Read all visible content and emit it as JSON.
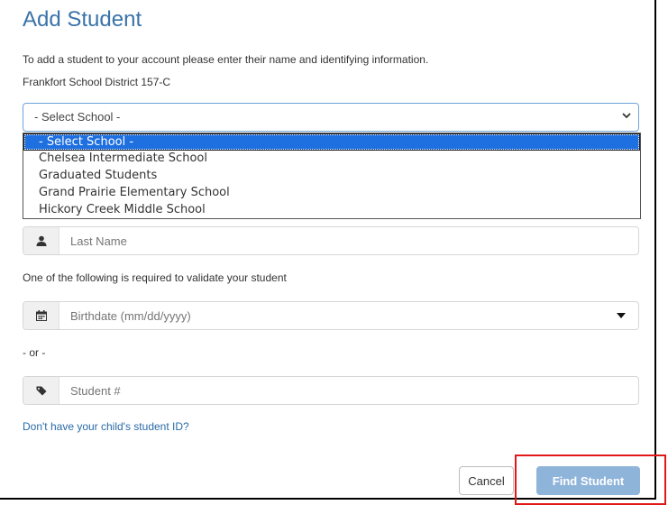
{
  "page": {
    "title": "Add Student",
    "instructions": "To add a student to your account please enter their name and identifying information.",
    "district": "Frankfort School District 157-C"
  },
  "school_select": {
    "selected": "- Select School -",
    "options": [
      "- Select School -",
      "Chelsea Intermediate School",
      "Graduated Students",
      "Grand Prairie Elementary School",
      "Hickory Creek Middle School"
    ]
  },
  "fields": {
    "last_name_placeholder": "Last Name",
    "validate_note": "One of the following is required to validate your student",
    "birthdate_placeholder": "Birthdate (mm/dd/yyyy)",
    "or_text": "- or -",
    "student_number_placeholder": "Student #"
  },
  "help_link": "Don't have your child's student ID?",
  "buttons": {
    "cancel": "Cancel",
    "find": "Find Student"
  },
  "colors": {
    "title": "#3a73a8",
    "link": "#2a6aa8",
    "primary_button": "#8fb4da",
    "dropdown_selected": "#1e6fe0",
    "highlight_box": "#e01818"
  },
  "icons": {
    "last_name": "user-icon",
    "birthdate": "calendar-icon",
    "student_number": "tag-icon",
    "select": "chevron-down-icon"
  }
}
